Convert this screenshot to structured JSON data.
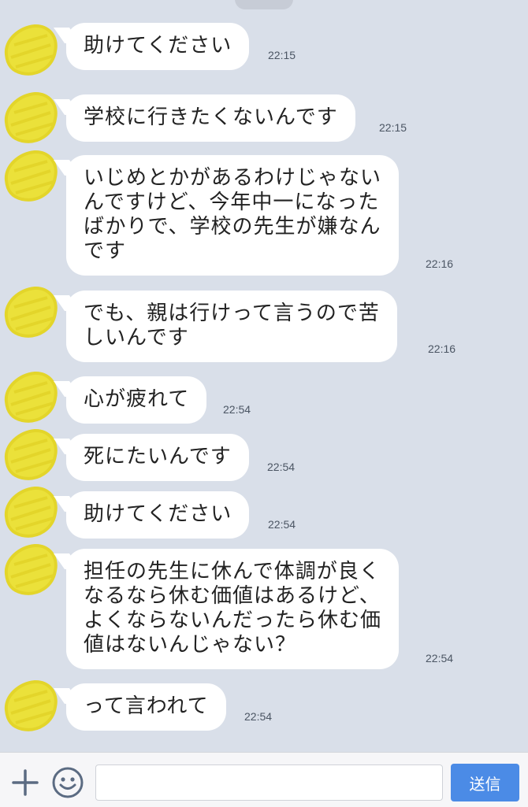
{
  "messages": [
    {
      "lines": [
        "助けてください"
      ],
      "time": "22:15"
    },
    {
      "lines": [
        "学校に行きたくないんです"
      ],
      "time": "22:15"
    },
    {
      "lines": [
        "いじめとかがあるわけじゃない",
        "んですけど、今年中一になった",
        "ばかりで、学校の先生が嫌なん",
        "です"
      ],
      "time": "22:16"
    },
    {
      "lines": [
        "でも、親は行けって言うので苦",
        "しいんです"
      ],
      "time": "22:16"
    },
    {
      "lines": [
        "心が疲れて"
      ],
      "time": "22:54"
    },
    {
      "lines": [
        "死にたいんです"
      ],
      "time": "22:54"
    },
    {
      "lines": [
        "助けてください"
      ],
      "time": "22:54"
    },
    {
      "lines": [
        "担任の先生に休んで体調が良く",
        "なるなら休む価値はあるけど、",
        "よくならないんだったら休む価",
        "値はないんじゃない？"
      ],
      "time": "22:54"
    },
    {
      "lines": [
        "って言われて"
      ],
      "time": "22:54"
    }
  ],
  "input_bar": {
    "plus_icon": "plus-icon",
    "emoji_icon": "smile-icon",
    "message_placeholder": "",
    "send_label": "送信"
  },
  "colors": {
    "background": "#d9dfe9",
    "bubble": "#ffffff",
    "avatar": "#ebe13a",
    "send_button": "#4b8be6"
  }
}
